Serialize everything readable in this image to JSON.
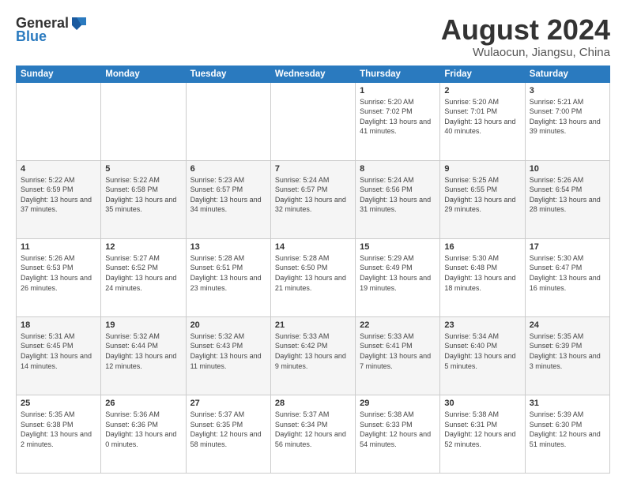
{
  "logo": {
    "general": "General",
    "blue": "Blue"
  },
  "title": "August 2024",
  "location": "Wulaocun, Jiangsu, China",
  "headers": [
    "Sunday",
    "Monday",
    "Tuesday",
    "Wednesday",
    "Thursday",
    "Friday",
    "Saturday"
  ],
  "weeks": [
    [
      {
        "day": "",
        "sunrise": "",
        "sunset": "",
        "daylight": ""
      },
      {
        "day": "",
        "sunrise": "",
        "sunset": "",
        "daylight": ""
      },
      {
        "day": "",
        "sunrise": "",
        "sunset": "",
        "daylight": ""
      },
      {
        "day": "",
        "sunrise": "",
        "sunset": "",
        "daylight": ""
      },
      {
        "day": "1",
        "sunrise": "Sunrise: 5:20 AM",
        "sunset": "Sunset: 7:02 PM",
        "daylight": "Daylight: 13 hours and 41 minutes."
      },
      {
        "day": "2",
        "sunrise": "Sunrise: 5:20 AM",
        "sunset": "Sunset: 7:01 PM",
        "daylight": "Daylight: 13 hours and 40 minutes."
      },
      {
        "day": "3",
        "sunrise": "Sunrise: 5:21 AM",
        "sunset": "Sunset: 7:00 PM",
        "daylight": "Daylight: 13 hours and 39 minutes."
      }
    ],
    [
      {
        "day": "4",
        "sunrise": "Sunrise: 5:22 AM",
        "sunset": "Sunset: 6:59 PM",
        "daylight": "Daylight: 13 hours and 37 minutes."
      },
      {
        "day": "5",
        "sunrise": "Sunrise: 5:22 AM",
        "sunset": "Sunset: 6:58 PM",
        "daylight": "Daylight: 13 hours and 35 minutes."
      },
      {
        "day": "6",
        "sunrise": "Sunrise: 5:23 AM",
        "sunset": "Sunset: 6:57 PM",
        "daylight": "Daylight: 13 hours and 34 minutes."
      },
      {
        "day": "7",
        "sunrise": "Sunrise: 5:24 AM",
        "sunset": "Sunset: 6:57 PM",
        "daylight": "Daylight: 13 hours and 32 minutes."
      },
      {
        "day": "8",
        "sunrise": "Sunrise: 5:24 AM",
        "sunset": "Sunset: 6:56 PM",
        "daylight": "Daylight: 13 hours and 31 minutes."
      },
      {
        "day": "9",
        "sunrise": "Sunrise: 5:25 AM",
        "sunset": "Sunset: 6:55 PM",
        "daylight": "Daylight: 13 hours and 29 minutes."
      },
      {
        "day": "10",
        "sunrise": "Sunrise: 5:26 AM",
        "sunset": "Sunset: 6:54 PM",
        "daylight": "Daylight: 13 hours and 28 minutes."
      }
    ],
    [
      {
        "day": "11",
        "sunrise": "Sunrise: 5:26 AM",
        "sunset": "Sunset: 6:53 PM",
        "daylight": "Daylight: 13 hours and 26 minutes."
      },
      {
        "day": "12",
        "sunrise": "Sunrise: 5:27 AM",
        "sunset": "Sunset: 6:52 PM",
        "daylight": "Daylight: 13 hours and 24 minutes."
      },
      {
        "day": "13",
        "sunrise": "Sunrise: 5:28 AM",
        "sunset": "Sunset: 6:51 PM",
        "daylight": "Daylight: 13 hours and 23 minutes."
      },
      {
        "day": "14",
        "sunrise": "Sunrise: 5:28 AM",
        "sunset": "Sunset: 6:50 PM",
        "daylight": "Daylight: 13 hours and 21 minutes."
      },
      {
        "day": "15",
        "sunrise": "Sunrise: 5:29 AM",
        "sunset": "Sunset: 6:49 PM",
        "daylight": "Daylight: 13 hours and 19 minutes."
      },
      {
        "day": "16",
        "sunrise": "Sunrise: 5:30 AM",
        "sunset": "Sunset: 6:48 PM",
        "daylight": "Daylight: 13 hours and 18 minutes."
      },
      {
        "day": "17",
        "sunrise": "Sunrise: 5:30 AM",
        "sunset": "Sunset: 6:47 PM",
        "daylight": "Daylight: 13 hours and 16 minutes."
      }
    ],
    [
      {
        "day": "18",
        "sunrise": "Sunrise: 5:31 AM",
        "sunset": "Sunset: 6:45 PM",
        "daylight": "Daylight: 13 hours and 14 minutes."
      },
      {
        "day": "19",
        "sunrise": "Sunrise: 5:32 AM",
        "sunset": "Sunset: 6:44 PM",
        "daylight": "Daylight: 13 hours and 12 minutes."
      },
      {
        "day": "20",
        "sunrise": "Sunrise: 5:32 AM",
        "sunset": "Sunset: 6:43 PM",
        "daylight": "Daylight: 13 hours and 11 minutes."
      },
      {
        "day": "21",
        "sunrise": "Sunrise: 5:33 AM",
        "sunset": "Sunset: 6:42 PM",
        "daylight": "Daylight: 13 hours and 9 minutes."
      },
      {
        "day": "22",
        "sunrise": "Sunrise: 5:33 AM",
        "sunset": "Sunset: 6:41 PM",
        "daylight": "Daylight: 13 hours and 7 minutes."
      },
      {
        "day": "23",
        "sunrise": "Sunrise: 5:34 AM",
        "sunset": "Sunset: 6:40 PM",
        "daylight": "Daylight: 13 hours and 5 minutes."
      },
      {
        "day": "24",
        "sunrise": "Sunrise: 5:35 AM",
        "sunset": "Sunset: 6:39 PM",
        "daylight": "Daylight: 13 hours and 3 minutes."
      }
    ],
    [
      {
        "day": "25",
        "sunrise": "Sunrise: 5:35 AM",
        "sunset": "Sunset: 6:38 PM",
        "daylight": "Daylight: 13 hours and 2 minutes."
      },
      {
        "day": "26",
        "sunrise": "Sunrise: 5:36 AM",
        "sunset": "Sunset: 6:36 PM",
        "daylight": "Daylight: 13 hours and 0 minutes."
      },
      {
        "day": "27",
        "sunrise": "Sunrise: 5:37 AM",
        "sunset": "Sunset: 6:35 PM",
        "daylight": "Daylight: 12 hours and 58 minutes."
      },
      {
        "day": "28",
        "sunrise": "Sunrise: 5:37 AM",
        "sunset": "Sunset: 6:34 PM",
        "daylight": "Daylight: 12 hours and 56 minutes."
      },
      {
        "day": "29",
        "sunrise": "Sunrise: 5:38 AM",
        "sunset": "Sunset: 6:33 PM",
        "daylight": "Daylight: 12 hours and 54 minutes."
      },
      {
        "day": "30",
        "sunrise": "Sunrise: 5:38 AM",
        "sunset": "Sunset: 6:31 PM",
        "daylight": "Daylight: 12 hours and 52 minutes."
      },
      {
        "day": "31",
        "sunrise": "Sunrise: 5:39 AM",
        "sunset": "Sunset: 6:30 PM",
        "daylight": "Daylight: 12 hours and 51 minutes."
      }
    ]
  ]
}
